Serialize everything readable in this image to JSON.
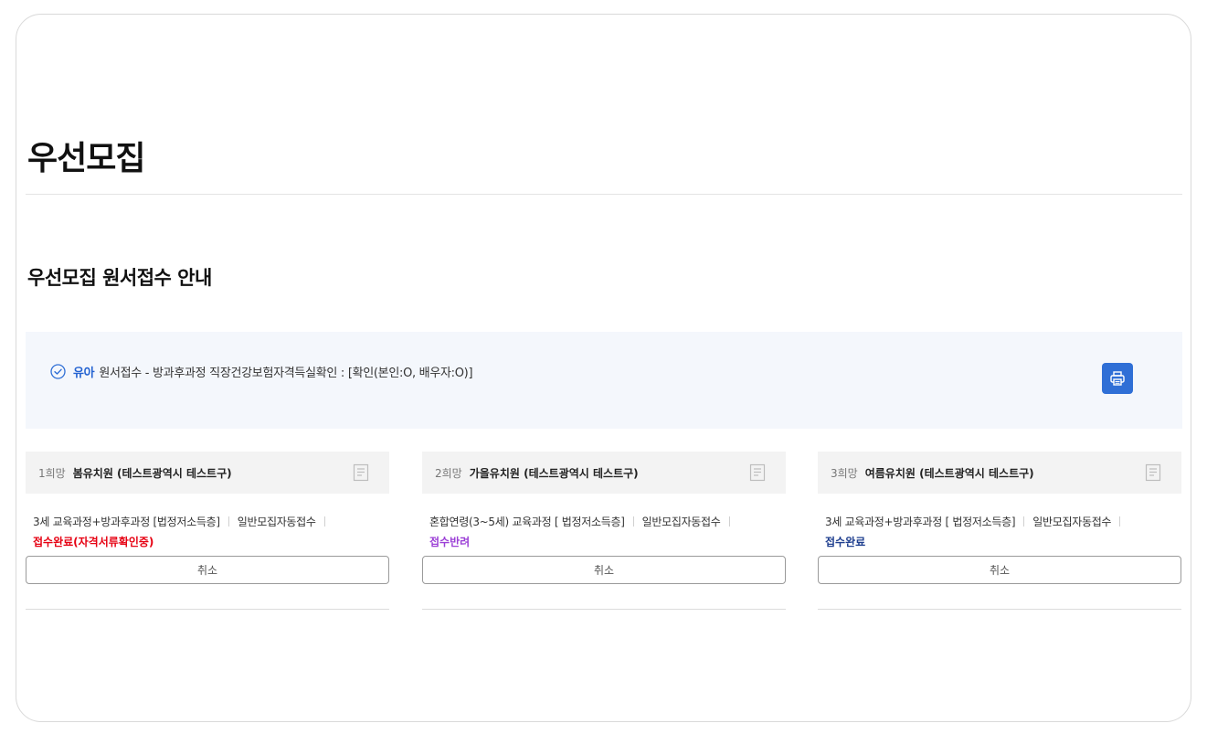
{
  "page": {
    "title": "우선모집",
    "section_title": "우선모집 원서접수 안내"
  },
  "info": {
    "prefix": "유아",
    "text": "원서접수 - 방과후과정 직장건강보험자격득실확인 : [확인(본인:O, 배우자:O)]",
    "print_icon": "printer-icon"
  },
  "cards": [
    {
      "rank": "1희망",
      "school": "봄유치원 (테스트광역시 테스트구)",
      "course": "3세 교육과정+방과후과정 [법정저소득층]",
      "type": "일반모집자동접수",
      "status": "접수완료(자격서류확인중)",
      "status_color": "#e60012",
      "cancel_label": "취소"
    },
    {
      "rank": "2희망",
      "school": "가을유치원 (테스트광역시 테스트구)",
      "course": "혼합연령(3~5세) 교육과정 [ 법정저소득층]",
      "type": "일반모집자동접수",
      "status": "접수반려",
      "status_color": "#9b3fd6",
      "cancel_label": "취소"
    },
    {
      "rank": "3희망",
      "school": "여름유치원 (테스트광역시 테스트구)",
      "course": "3세 교육과정+방과후과정 [ 법정저소득층]",
      "type": "일반모집자동접수",
      "status": "접수완료",
      "status_color": "#1f3f8f",
      "cancel_label": "취소"
    }
  ],
  "colors": {
    "accent": "#2f6fd6",
    "info_bg": "#f4f7fc",
    "card_header_bg": "#f3f3f3"
  }
}
